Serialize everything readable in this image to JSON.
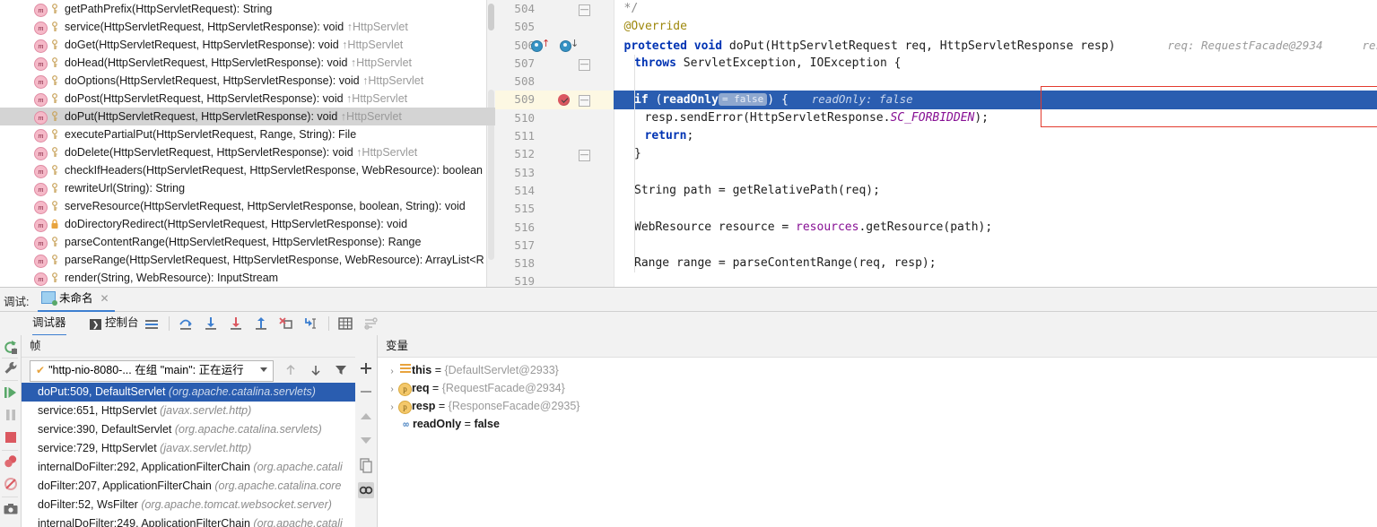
{
  "method_popup": {
    "items": [
      {
        "name": "getPathPrefix(HttpServletRequest): String",
        "sup": "",
        "icon": "method-icon",
        "sel": false,
        "lock": false
      },
      {
        "name": "service(HttpServletRequest, HttpServletResponse): void",
        "sup": "↑HttpServlet",
        "icon": "method-icon",
        "sel": false,
        "lock": false
      },
      {
        "name": "doGet(HttpServletRequest, HttpServletResponse): void",
        "sup": "↑HttpServlet",
        "icon": "method-icon",
        "sel": false,
        "lock": false
      },
      {
        "name": "doHead(HttpServletRequest, HttpServletResponse): void",
        "sup": "↑HttpServlet",
        "icon": "method-icon",
        "sel": false,
        "lock": false
      },
      {
        "name": "doOptions(HttpServletRequest, HttpServletResponse): void",
        "sup": "↑HttpServlet",
        "icon": "method-icon",
        "sel": false,
        "lock": false
      },
      {
        "name": "doPost(HttpServletRequest, HttpServletResponse): void",
        "sup": "↑HttpServlet",
        "icon": "method-icon",
        "sel": false,
        "lock": false
      },
      {
        "name": "doPut(HttpServletRequest, HttpServletResponse): void",
        "sup": "↑HttpServlet",
        "icon": "method-icon",
        "sel": true,
        "lock": false
      },
      {
        "name": "executePartialPut(HttpServletRequest, Range, String): File",
        "sup": "",
        "icon": "method-icon",
        "sel": false,
        "lock": false
      },
      {
        "name": "doDelete(HttpServletRequest, HttpServletResponse): void",
        "sup": "↑HttpServlet",
        "icon": "method-icon",
        "sel": false,
        "lock": false
      },
      {
        "name": "checkIfHeaders(HttpServletRequest, HttpServletResponse, WebResource): boolean",
        "sup": "",
        "icon": "method-icon",
        "sel": false,
        "lock": false
      },
      {
        "name": "rewriteUrl(String): String",
        "sup": "",
        "icon": "method-icon",
        "sel": false,
        "lock": false
      },
      {
        "name": "serveResource(HttpServletRequest, HttpServletResponse, boolean, String): void",
        "sup": "",
        "icon": "method-icon",
        "sel": false,
        "lock": false
      },
      {
        "name": "doDirectoryRedirect(HttpServletRequest, HttpServletResponse): void",
        "sup": "",
        "icon": "method-icon",
        "sel": false,
        "lock": true
      },
      {
        "name": "parseContentRange(HttpServletRequest, HttpServletResponse): Range",
        "sup": "",
        "icon": "method-icon",
        "sel": false,
        "lock": false
      },
      {
        "name": "parseRange(HttpServletRequest, HttpServletResponse, WebResource): ArrayList<R",
        "sup": "",
        "icon": "method-icon",
        "sel": false,
        "lock": false
      },
      {
        "name": "render(String, WebResource): InputStream",
        "sup": "",
        "icon": "method-icon",
        "sel": false,
        "lock": false
      }
    ]
  },
  "editor": {
    "lines": [
      {
        "no": "504",
        "text": "*/",
        "style": "comment",
        "indent": 1
      },
      {
        "no": "505",
        "text": "@Override",
        "style": "annotation",
        "indent": 1
      },
      {
        "no": "506",
        "text": "protected void doPut(HttpServletRequest req, HttpServletResponse resp)",
        "style": "decl",
        "indent": 1
      },
      {
        "no": "507",
        "text": "throws ServletException, IOException {",
        "style": "throws",
        "indent": 2
      },
      {
        "no": "508",
        "text": "",
        "style": "plain",
        "indent": 0
      },
      {
        "no": "509",
        "text": "if (readOnly) {",
        "style": "exec-if",
        "indent": 2
      },
      {
        "no": "510",
        "text": "resp.sendError(HttpServletResponse.SC_FORBIDDEN);",
        "style": "senderror",
        "indent": 3
      },
      {
        "no": "511",
        "text": "return;",
        "style": "return",
        "indent": 3
      },
      {
        "no": "512",
        "text": "}",
        "style": "plain",
        "indent": 2
      },
      {
        "no": "513",
        "text": "",
        "style": "plain",
        "indent": 0
      },
      {
        "no": "514",
        "text": "String path = getRelativePath(req);",
        "style": "path",
        "indent": 2
      },
      {
        "no": "515",
        "text": "",
        "style": "plain",
        "indent": 0
      },
      {
        "no": "516",
        "text": "WebResource resource = resources.getResource(path);",
        "style": "res",
        "indent": 2
      },
      {
        "no": "517",
        "text": "",
        "style": "plain",
        "indent": 0
      },
      {
        "no": "518",
        "text": "Range range = parseContentRange(req, resp);",
        "style": "range",
        "indent": 2
      },
      {
        "no": "519",
        "text": "",
        "style": "plain",
        "indent": 0
      }
    ],
    "line506": {
      "kw_protected": "protected",
      "kw_void": "void",
      "name": "doPut",
      "params": "(HttpServletRequest req, HttpServletResponse resp)",
      "hint_req": "req: RequestFacade@2934",
      "hint_resp": "resp: R"
    },
    "line507": {
      "kw": "throws",
      "rest": "ServletException, IOException {"
    },
    "line509": {
      "kw_if": "if",
      "open": "(",
      "var": "readOnly",
      "badge": "= false",
      "close": ") {",
      "hint": "readOnly: false"
    },
    "line510": {
      "obj": "resp.sendError(HttpServletResponse.",
      "constant": "SC_FORBIDDEN",
      ";": ");"
    },
    "line511": {
      "kw": "return",
      ";": ";"
    },
    "line514": {
      "text": "String path = getRelativePath(req);"
    },
    "line516": {
      "pre": "WebResource resource = ",
      "field": "resources",
      ".": ".getResource(path);"
    },
    "line518": {
      "text": "Range range = parseContentRange(req, resp);"
    },
    "line504": {
      "text": "*/"
    },
    "line505": {
      "text": "@Override"
    }
  },
  "debug": {
    "label": "调试:",
    "tab_title": "未命名",
    "tab_close": "✕",
    "subtabs": [
      {
        "label": "调试器",
        "active": true,
        "icon": "debugger-icon"
      },
      {
        "label": "控制台",
        "active": false,
        "icon": "console-icon"
      }
    ],
    "toolbar_icons": [
      "frames-icon",
      "step-over-icon",
      "step-into-icon",
      "force-step-into-icon",
      "step-out-icon",
      "drop-frame-icon",
      "run-to-cursor-icon",
      "evaluate-expression-icon",
      "settings-icon"
    ],
    "left_icons": [
      "rerun-icon",
      "settings-wrench-icon",
      "resume-icon",
      "pause-icon",
      "stop-icon",
      "view-breakpoints-icon",
      "mute-breakpoints-icon",
      "screenshot-icon"
    ],
    "frames": {
      "header": "帧",
      "thread": "\"http-nio-8080-... 在组 \"main\": 正在运行",
      "thread_status_icon": "running-check-icon",
      "buttons": [
        "move-up-icon",
        "move-down-icon",
        "filter-icon"
      ],
      "side_buttons": [
        "add-icon",
        "remove-icon",
        "up-icon",
        "down-icon",
        "copy-icon",
        "toggle-icon"
      ],
      "rows": [
        {
          "method": "doPut:509, DefaultServlet",
          "pkg": "(org.apache.catalina.servlets)",
          "sel": true
        },
        {
          "method": "service:651, HttpServlet",
          "pkg": "(javax.servlet.http)",
          "sel": false
        },
        {
          "method": "service:390, DefaultServlet",
          "pkg": "(org.apache.catalina.servlets)",
          "sel": false
        },
        {
          "method": "service:729, HttpServlet",
          "pkg": "(javax.servlet.http)",
          "sel": false
        },
        {
          "method": "internalDoFilter:292, ApplicationFilterChain",
          "pkg": "(org.apache.catali",
          "sel": false
        },
        {
          "method": "doFilter:207, ApplicationFilterChain",
          "pkg": "(org.apache.catalina.core",
          "sel": false
        },
        {
          "method": "doFilter:52, WsFilter",
          "pkg": "(org.apache.tomcat.websocket.server)",
          "sel": false
        },
        {
          "method": "internalDoFilter:249, ApplicationFilterChain",
          "pkg": "(org.apache.catali",
          "sel": false
        }
      ]
    },
    "variables": {
      "header": "变量",
      "rows": [
        {
          "chevron": "›",
          "icon": "object-icon",
          "name": "this",
          "eq": " = ",
          "value": "{DefaultServlet@2933}",
          "bold_value": false
        },
        {
          "chevron": "›",
          "icon": "parameter-icon",
          "name": "req",
          "eq": " = ",
          "value": "{RequestFacade@2934}",
          "bold_value": false
        },
        {
          "chevron": "›",
          "icon": "parameter-icon",
          "name": "resp",
          "eq": " = ",
          "value": "{ResponseFacade@2935}",
          "bold_value": false
        },
        {
          "chevron": "",
          "icon": "primitive-icon",
          "name": "readOnly",
          "eq": " = ",
          "value": "false",
          "bold_value": true
        }
      ]
    }
  },
  "colors": {
    "exec_line": "#2a5db0",
    "caret_line": "#fdf8e3",
    "breakpoint": "#db5860",
    "red_highlight_box": "#e33b2e",
    "accent": "#3d7fd0",
    "keyword": "#0033b3",
    "constant": "#871094",
    "annotation": "#9e880d",
    "hint": "#9a9a9a"
  }
}
